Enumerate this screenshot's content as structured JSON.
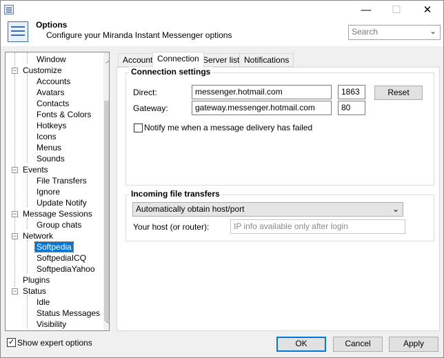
{
  "window": {
    "minimize_glyph": "—",
    "maximize_glyph": "☐",
    "close_glyph": "✕"
  },
  "header": {
    "title": "Options",
    "subtitle": "Configure your Miranda Instant Messenger options",
    "search_placeholder": "Search"
  },
  "tree": {
    "items": [
      {
        "label": "Window"
      },
      {
        "label": "Customize"
      },
      {
        "label": "Accounts"
      },
      {
        "label": "Avatars"
      },
      {
        "label": "Contacts"
      },
      {
        "label": "Fonts & Colors"
      },
      {
        "label": "Hotkeys"
      },
      {
        "label": "Icons"
      },
      {
        "label": "Menus"
      },
      {
        "label": "Sounds"
      },
      {
        "label": "Events"
      },
      {
        "label": "File Transfers"
      },
      {
        "label": "Ignore"
      },
      {
        "label": "Update Notify"
      },
      {
        "label": "Message Sessions"
      },
      {
        "label": "Group chats"
      },
      {
        "label": "Network"
      },
      {
        "label": "Softpedia"
      },
      {
        "label": "SoftpediaICQ"
      },
      {
        "label": "SoftpediaYahoo"
      },
      {
        "label": "Plugins"
      },
      {
        "label": "Status"
      },
      {
        "label": "Idle"
      },
      {
        "label": "Status Messages"
      },
      {
        "label": "Visibility"
      }
    ]
  },
  "tabs": [
    {
      "label": "Account"
    },
    {
      "label": "Connection"
    },
    {
      "label": "Server list"
    },
    {
      "label": "Notifications"
    }
  ],
  "connection": {
    "group_title": "Connection settings",
    "direct_label": "Direct:",
    "direct_host": "messenger.hotmail.com",
    "direct_port": "1863",
    "reset_label": "Reset",
    "gateway_label": "Gateway:",
    "gateway_host": "gateway.messenger.hotmail.com",
    "gateway_port": "80",
    "notify_label": "Notify me when a message delivery has failed"
  },
  "incoming": {
    "group_title": "Incoming file transfers",
    "mode_value": "Automatically obtain host/port",
    "host_label": "Your host (or router):",
    "host_placeholder": "IP info available only after login"
  },
  "footer": {
    "expert_label": "Show expert options",
    "ok_label": "OK",
    "cancel_label": "Cancel",
    "apply_label": "Apply"
  }
}
